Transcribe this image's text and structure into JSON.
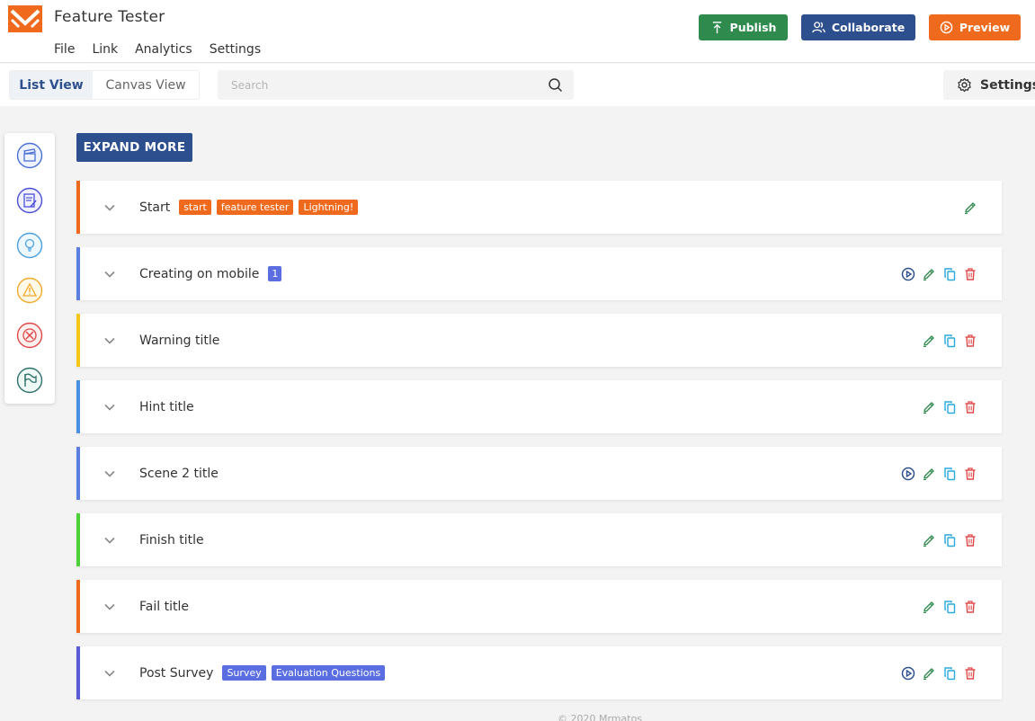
{
  "header": {
    "title": "Feature Tester",
    "menu": [
      "File",
      "Link",
      "Analytics",
      "Settings"
    ],
    "buttons": {
      "publish": "Publish",
      "collaborate": "Collaborate",
      "preview": "Preview"
    }
  },
  "toolbar": {
    "views": {
      "list": "List View",
      "canvas": "Canvas View"
    },
    "search_placeholder": "Search",
    "settings_label": "Settings"
  },
  "palette": [
    "clapperboard-icon",
    "document-edit-icon",
    "lightbulb-icon",
    "warning-icon",
    "fail-icon",
    "finish-flag-icon"
  ],
  "main": {
    "expand_label": "EXPAND MORE",
    "scenes": [
      {
        "title": "Start",
        "color": "#f06a1d",
        "tags": [
          "start",
          "feature tester",
          "Lightning!"
        ],
        "tag_color": "orange",
        "actions": [
          "edit"
        ]
      },
      {
        "title": "Creating on mobile",
        "color": "#5b7fe0",
        "tags": [
          "1"
        ],
        "tag_color": "num",
        "actions": [
          "play",
          "edit",
          "copy",
          "delete"
        ]
      },
      {
        "title": "Warning title",
        "color": "#f5c518",
        "tags": [],
        "actions": [
          "edit",
          "copy",
          "delete"
        ]
      },
      {
        "title": "Hint title",
        "color": "#4a90e2",
        "tags": [],
        "actions": [
          "edit",
          "copy",
          "delete"
        ]
      },
      {
        "title": "Scene 2 title",
        "color": "#5b7fe0",
        "tags": [],
        "actions": [
          "play",
          "edit",
          "copy",
          "delete"
        ]
      },
      {
        "title": "Finish title",
        "color": "#4cd137",
        "tags": [],
        "actions": [
          "edit",
          "copy",
          "delete"
        ]
      },
      {
        "title": "Fail title",
        "color": "#f06a1d",
        "tags": [],
        "actions": [
          "edit",
          "copy",
          "delete"
        ]
      },
      {
        "title": "Post Survey",
        "color": "#5b5bd6",
        "tags": [
          "Survey",
          "Evaluation Questions"
        ],
        "tag_color": "blue",
        "actions": [
          "play",
          "edit",
          "copy",
          "delete"
        ]
      }
    ]
  },
  "footer": "© 2020 Mrmatos",
  "colors": {
    "primary": "#2d4f8e",
    "publish": "#2f8a4e",
    "preview": "#f06a1d",
    "edit": "#2f8a4e",
    "copy": "#29a9e0",
    "delete": "#e04848",
    "play": "#2d4f8e"
  }
}
